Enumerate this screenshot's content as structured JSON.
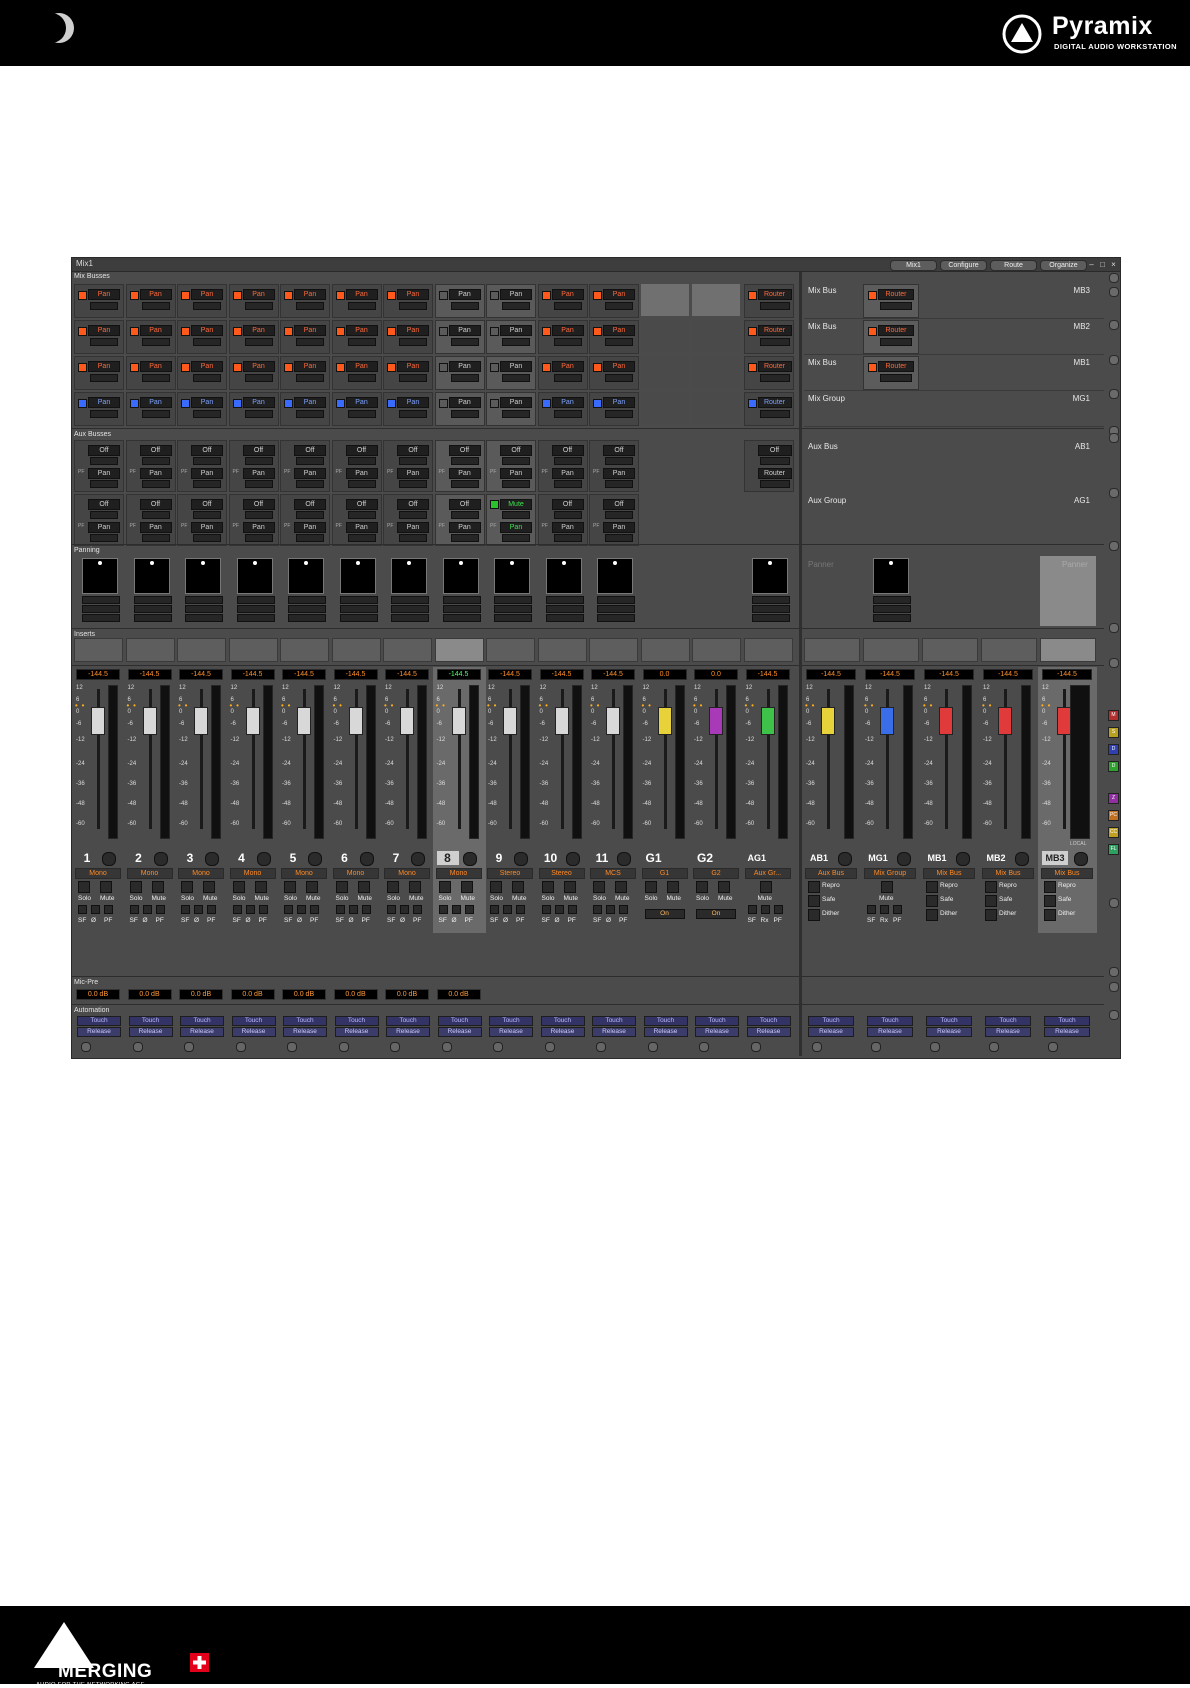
{
  "header": {
    "brand": "Pyramix",
    "brand_sub": "DIGITAL AUDIO WORKSTATION"
  },
  "footer": {
    "brand": "MERGING",
    "brand_sub": "AUDIO FOR THE NETWORKING AGE"
  },
  "window": {
    "title": "Mix1",
    "tabs": [
      "Mix1",
      "Configure",
      "Route",
      "Organize"
    ]
  },
  "sections": {
    "mix_busses": "Mix Busses",
    "aux_busses": "Aux Busses",
    "panning": "Panning",
    "inserts": "Inserts",
    "mic_pre": "Mic-Pre",
    "automation": "Automation"
  },
  "buttons": {
    "pan": "Pan",
    "router": "Router",
    "off": "Off",
    "mute": "Mute"
  },
  "bus_rows": [
    {
      "label": "Mix Bus",
      "name": "MB3"
    },
    {
      "label": "Mix Bus",
      "name": "MB2"
    },
    {
      "label": "Mix Bus",
      "name": "MB1"
    },
    {
      "label": "Mix Group",
      "name": "MG1"
    }
  ],
  "aux_rows": [
    {
      "label": "Aux Bus",
      "name": "AB1"
    },
    {
      "label": "Aux Group",
      "name": "AG1"
    }
  ],
  "panner_labels": [
    "Panner",
    "Panner"
  ],
  "scale": [
    "12",
    "6",
    "0",
    "-6",
    "-12",
    "-24",
    "-36",
    "-48",
    "-60"
  ],
  "channels": [
    {
      "num": "1",
      "type": "Mono",
      "level": "-144.5",
      "micpre": "0.0 dB"
    },
    {
      "num": "2",
      "type": "Mono",
      "level": "-144.5",
      "micpre": "0.0 dB"
    },
    {
      "num": "3",
      "type": "Mono",
      "level": "-144.5",
      "micpre": "0.0 dB"
    },
    {
      "num": "4",
      "type": "Mono",
      "level": "-144.5",
      "micpre": "0.0 dB"
    },
    {
      "num": "5",
      "type": "Mono",
      "level": "-144.5",
      "micpre": "0.0 dB"
    },
    {
      "num": "6",
      "type": "Mono",
      "level": "-144.5",
      "micpre": "0.0 dB"
    },
    {
      "num": "7",
      "type": "Mono",
      "level": "-144.5",
      "micpre": "0.0 dB"
    },
    {
      "num": "8",
      "type": "Mono",
      "level": "-144.5",
      "micpre": "0.0 dB"
    },
    {
      "num": "9",
      "type": "Stereo",
      "level": "-144.5"
    },
    {
      "num": "10",
      "type": "Stereo",
      "level": "-144.5"
    },
    {
      "num": "11",
      "type": "MCS",
      "level": "-144.5"
    },
    {
      "num": "G1",
      "type": "G1",
      "level": "0.0"
    },
    {
      "num": "G2",
      "type": "G2",
      "level": "0.0"
    },
    {
      "num": "AG1",
      "type": "Aux Gr...",
      "level": "-144.5"
    }
  ],
  "bus_strips": [
    {
      "num": "AB1",
      "type": "Aux Bus",
      "level": "-144.5"
    },
    {
      "num": "MG1",
      "type": "Mix Group",
      "level": "-144.5"
    },
    {
      "num": "MB1",
      "type": "Mix Bus",
      "level": "-144.5"
    },
    {
      "num": "MB2",
      "type": "Mix Bus",
      "level": "-144.5"
    },
    {
      "num": "MB3",
      "type": "Mix Bus",
      "level": "-144.5"
    }
  ],
  "strip_labels": {
    "solo": "Solo",
    "mute": "Mute",
    "sf": "SF",
    "phase": "Ø",
    "pf": "PF",
    "rx": "Rx",
    "on": "On",
    "repro": "Repro",
    "safe": "Safe",
    "dither": "Dither",
    "touch": "Touch",
    "release": "Release",
    "pf_small": "PF",
    "meter_mode": "LOCAL"
  },
  "side_icons": [
    "M",
    "S",
    "D",
    "D",
    "Z",
    "PC",
    "CC",
    "FL"
  ],
  "colors": {
    "accent_orange": "#ff6a3c",
    "accent_blue": "#3a6bff",
    "accent_green": "#29c42c",
    "fader_yellow": "#e8d23a",
    "fader_purple": "#a83ab8",
    "fader_green": "#3fc24a",
    "fader_blue": "#3a6ee8",
    "fader_red": "#e03a3a"
  }
}
